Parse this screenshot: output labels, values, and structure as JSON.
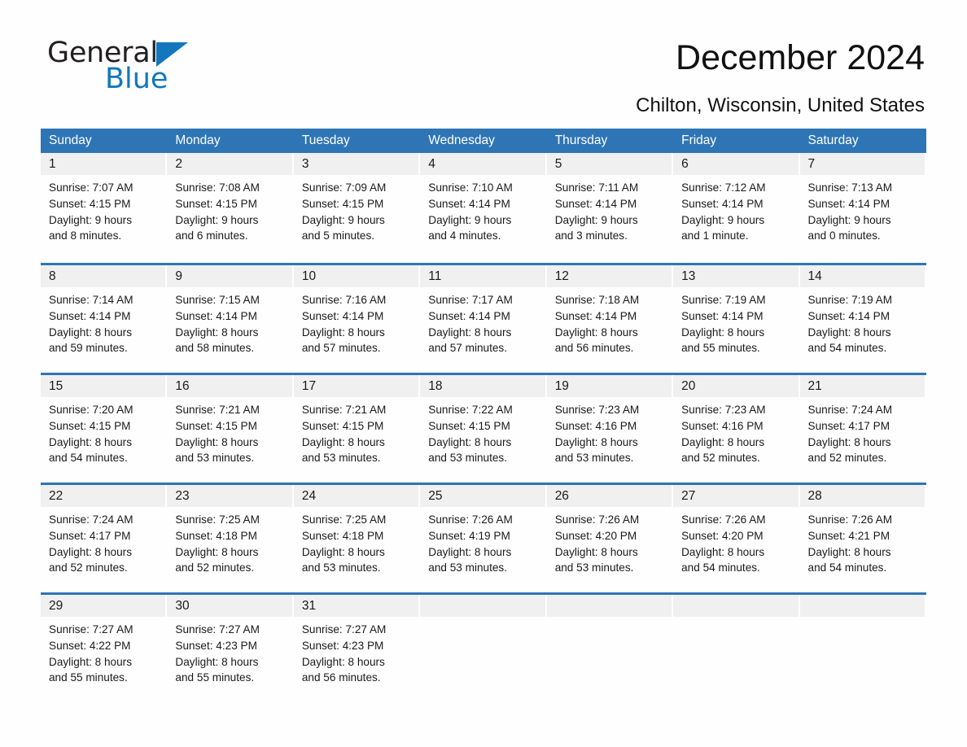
{
  "logo": {
    "word_one": "General",
    "word_two": "Blue",
    "triangle_color": "#1277bc",
    "text_color": "#231f20"
  },
  "header": {
    "title": "December 2024",
    "subtitle": "Chilton, Wisconsin, United States"
  },
  "theme": {
    "header_blue": "#2e75b6",
    "day_band_gray": "#f0f0f0",
    "page_background": "#fefefe",
    "text_color": "#1a1a1a"
  },
  "weekdays": [
    "Sunday",
    "Monday",
    "Tuesday",
    "Wednesday",
    "Thursday",
    "Friday",
    "Saturday"
  ],
  "weeks": [
    [
      {
        "day": "1",
        "sunrise": "Sunrise: 7:07 AM",
        "sunset": "Sunset: 4:15 PM",
        "daylight1": "Daylight: 9 hours",
        "daylight2": "and 8 minutes."
      },
      {
        "day": "2",
        "sunrise": "Sunrise: 7:08 AM",
        "sunset": "Sunset: 4:15 PM",
        "daylight1": "Daylight: 9 hours",
        "daylight2": "and 6 minutes."
      },
      {
        "day": "3",
        "sunrise": "Sunrise: 7:09 AM",
        "sunset": "Sunset: 4:15 PM",
        "daylight1": "Daylight: 9 hours",
        "daylight2": "and 5 minutes."
      },
      {
        "day": "4",
        "sunrise": "Sunrise: 7:10 AM",
        "sunset": "Sunset: 4:14 PM",
        "daylight1": "Daylight: 9 hours",
        "daylight2": "and 4 minutes."
      },
      {
        "day": "5",
        "sunrise": "Sunrise: 7:11 AM",
        "sunset": "Sunset: 4:14 PM",
        "daylight1": "Daylight: 9 hours",
        "daylight2": "and 3 minutes."
      },
      {
        "day": "6",
        "sunrise": "Sunrise: 7:12 AM",
        "sunset": "Sunset: 4:14 PM",
        "daylight1": "Daylight: 9 hours",
        "daylight2": "and 1 minute."
      },
      {
        "day": "7",
        "sunrise": "Sunrise: 7:13 AM",
        "sunset": "Sunset: 4:14 PM",
        "daylight1": "Daylight: 9 hours",
        "daylight2": "and 0 minutes."
      }
    ],
    [
      {
        "day": "8",
        "sunrise": "Sunrise: 7:14 AM",
        "sunset": "Sunset: 4:14 PM",
        "daylight1": "Daylight: 8 hours",
        "daylight2": "and 59 minutes."
      },
      {
        "day": "9",
        "sunrise": "Sunrise: 7:15 AM",
        "sunset": "Sunset: 4:14 PM",
        "daylight1": "Daylight: 8 hours",
        "daylight2": "and 58 minutes."
      },
      {
        "day": "10",
        "sunrise": "Sunrise: 7:16 AM",
        "sunset": "Sunset: 4:14 PM",
        "daylight1": "Daylight: 8 hours",
        "daylight2": "and 57 minutes."
      },
      {
        "day": "11",
        "sunrise": "Sunrise: 7:17 AM",
        "sunset": "Sunset: 4:14 PM",
        "daylight1": "Daylight: 8 hours",
        "daylight2": "and 57 minutes."
      },
      {
        "day": "12",
        "sunrise": "Sunrise: 7:18 AM",
        "sunset": "Sunset: 4:14 PM",
        "daylight1": "Daylight: 8 hours",
        "daylight2": "and 56 minutes."
      },
      {
        "day": "13",
        "sunrise": "Sunrise: 7:19 AM",
        "sunset": "Sunset: 4:14 PM",
        "daylight1": "Daylight: 8 hours",
        "daylight2": "and 55 minutes."
      },
      {
        "day": "14",
        "sunrise": "Sunrise: 7:19 AM",
        "sunset": "Sunset: 4:14 PM",
        "daylight1": "Daylight: 8 hours",
        "daylight2": "and 54 minutes."
      }
    ],
    [
      {
        "day": "15",
        "sunrise": "Sunrise: 7:20 AM",
        "sunset": "Sunset: 4:15 PM",
        "daylight1": "Daylight: 8 hours",
        "daylight2": "and 54 minutes."
      },
      {
        "day": "16",
        "sunrise": "Sunrise: 7:21 AM",
        "sunset": "Sunset: 4:15 PM",
        "daylight1": "Daylight: 8 hours",
        "daylight2": "and 53 minutes."
      },
      {
        "day": "17",
        "sunrise": "Sunrise: 7:21 AM",
        "sunset": "Sunset: 4:15 PM",
        "daylight1": "Daylight: 8 hours",
        "daylight2": "and 53 minutes."
      },
      {
        "day": "18",
        "sunrise": "Sunrise: 7:22 AM",
        "sunset": "Sunset: 4:15 PM",
        "daylight1": "Daylight: 8 hours",
        "daylight2": "and 53 minutes."
      },
      {
        "day": "19",
        "sunrise": "Sunrise: 7:23 AM",
        "sunset": "Sunset: 4:16 PM",
        "daylight1": "Daylight: 8 hours",
        "daylight2": "and 53 minutes."
      },
      {
        "day": "20",
        "sunrise": "Sunrise: 7:23 AM",
        "sunset": "Sunset: 4:16 PM",
        "daylight1": "Daylight: 8 hours",
        "daylight2": "and 52 minutes."
      },
      {
        "day": "21",
        "sunrise": "Sunrise: 7:24 AM",
        "sunset": "Sunset: 4:17 PM",
        "daylight1": "Daylight: 8 hours",
        "daylight2": "and 52 minutes."
      }
    ],
    [
      {
        "day": "22",
        "sunrise": "Sunrise: 7:24 AM",
        "sunset": "Sunset: 4:17 PM",
        "daylight1": "Daylight: 8 hours",
        "daylight2": "and 52 minutes."
      },
      {
        "day": "23",
        "sunrise": "Sunrise: 7:25 AM",
        "sunset": "Sunset: 4:18 PM",
        "daylight1": "Daylight: 8 hours",
        "daylight2": "and 52 minutes."
      },
      {
        "day": "24",
        "sunrise": "Sunrise: 7:25 AM",
        "sunset": "Sunset: 4:18 PM",
        "daylight1": "Daylight: 8 hours",
        "daylight2": "and 53 minutes."
      },
      {
        "day": "25",
        "sunrise": "Sunrise: 7:26 AM",
        "sunset": "Sunset: 4:19 PM",
        "daylight1": "Daylight: 8 hours",
        "daylight2": "and 53 minutes."
      },
      {
        "day": "26",
        "sunrise": "Sunrise: 7:26 AM",
        "sunset": "Sunset: 4:20 PM",
        "daylight1": "Daylight: 8 hours",
        "daylight2": "and 53 minutes."
      },
      {
        "day": "27",
        "sunrise": "Sunrise: 7:26 AM",
        "sunset": "Sunset: 4:20 PM",
        "daylight1": "Daylight: 8 hours",
        "daylight2": "and 54 minutes."
      },
      {
        "day": "28",
        "sunrise": "Sunrise: 7:26 AM",
        "sunset": "Sunset: 4:21 PM",
        "daylight1": "Daylight: 8 hours",
        "daylight2": "and 54 minutes."
      }
    ],
    [
      {
        "day": "29",
        "sunrise": "Sunrise: 7:27 AM",
        "sunset": "Sunset: 4:22 PM",
        "daylight1": "Daylight: 8 hours",
        "daylight2": "and 55 minutes."
      },
      {
        "day": "30",
        "sunrise": "Sunrise: 7:27 AM",
        "sunset": "Sunset: 4:23 PM",
        "daylight1": "Daylight: 8 hours",
        "daylight2": "and 55 minutes."
      },
      {
        "day": "31",
        "sunrise": "Sunrise: 7:27 AM",
        "sunset": "Sunset: 4:23 PM",
        "daylight1": "Daylight: 8 hours",
        "daylight2": "and 56 minutes."
      },
      {
        "day": "",
        "sunrise": "",
        "sunset": "",
        "daylight1": "",
        "daylight2": ""
      },
      {
        "day": "",
        "sunrise": "",
        "sunset": "",
        "daylight1": "",
        "daylight2": ""
      },
      {
        "day": "",
        "sunrise": "",
        "sunset": "",
        "daylight1": "",
        "daylight2": ""
      },
      {
        "day": "",
        "sunrise": "",
        "sunset": "",
        "daylight1": "",
        "daylight2": ""
      }
    ]
  ]
}
